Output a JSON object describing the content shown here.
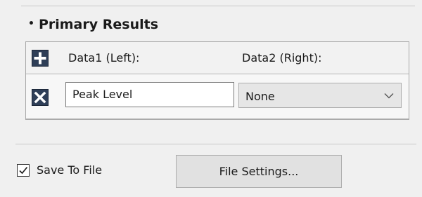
{
  "primary_results": {
    "bullet": "•",
    "title": "Primary Results",
    "columns": {
      "left_header": "Data1 (Left):",
      "right_header": "Data2 (Right):"
    },
    "rows": [
      {
        "data1_value": "Peak Level",
        "data2_selected": "None"
      }
    ]
  },
  "save": {
    "checked": true,
    "label": "Save To File",
    "settings_button": "File Settings..."
  },
  "icons": {
    "add": "plus-icon",
    "remove": "x-icon",
    "dropdown": "chevron-down-icon",
    "check": "check-icon"
  },
  "colors": {
    "icon_button_bg": "#2e3e57"
  }
}
